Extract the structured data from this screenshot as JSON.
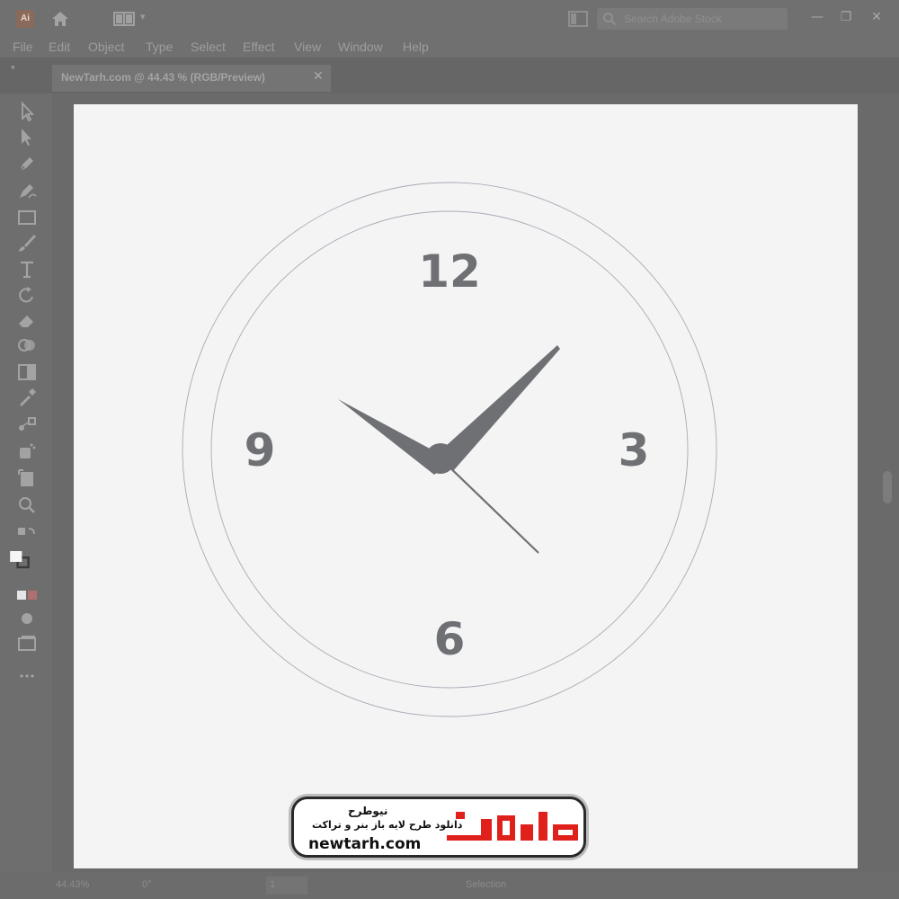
{
  "app": {
    "logo_text": "Ai",
    "search_placeholder": "Search Adobe Stock",
    "menu": [
      "File",
      "Edit",
      "Object",
      "Type",
      "Select",
      "Effect",
      "View",
      "Window",
      "Help"
    ],
    "window_controls": {
      "minimize": "—",
      "restore": "❐",
      "close": "✕"
    }
  },
  "document_tab": {
    "title": "NewTarh.com @ 44.43 % (RGB/Preview)",
    "close": "✕"
  },
  "toolbar": {
    "tools": [
      "selection-tool",
      "direct-selection-tool",
      "pen-tool",
      "curvature-tool",
      "rectangle-tool",
      "paintbrush-tool",
      "type-tool",
      "rotate-tool",
      "eraser-tool",
      "shape-builder-tool",
      "gradient-tool",
      "eyedropper-tool",
      "blend-tool",
      "symbol-sprayer-tool",
      "artboard-tool",
      "zoom-tool"
    ]
  },
  "clock": {
    "numerals": {
      "twelve": "12",
      "three": "3",
      "six": "6",
      "nine": "9"
    },
    "face_color": "#f4f4f5",
    "hand_color": "#6e7073",
    "ring_color": "#a9a9b4",
    "time_shown": {
      "hour": 9,
      "minute": 7,
      "second": 22
    }
  },
  "statusbar": {
    "zoom": "44.43%",
    "rotation": "0°",
    "page": "1",
    "mode": "Selection"
  },
  "watermark": {
    "site_name": "نیوطرح",
    "tagline": "دانلود طرح لایه باز بنر و تراکت",
    "url": "newtarh.com",
    "logo_color": "#e0201a"
  }
}
